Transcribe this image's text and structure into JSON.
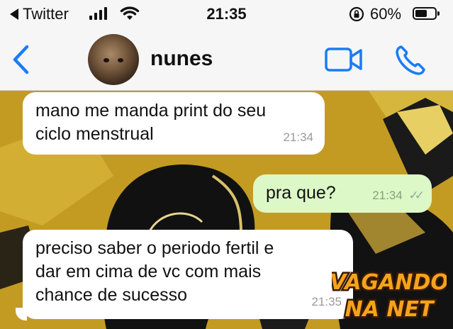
{
  "status_bar": {
    "back_app_label": "Twitter",
    "time": "21:35",
    "battery_percent": "60%",
    "battery_level": 0.6
  },
  "header": {
    "contact_name": "nunes",
    "icons": [
      "back-chevron-icon",
      "avatar",
      "video-call-icon",
      "phone-call-icon"
    ]
  },
  "messages": [
    {
      "direction": "incoming",
      "text_lines": [
        "mano me manda print do seu",
        "ciclo menstrual"
      ],
      "time": "21:34"
    },
    {
      "direction": "outgoing",
      "text_lines": [
        "pra que?"
      ],
      "time": "21:34",
      "status": "read"
    },
    {
      "direction": "incoming",
      "text_lines": [
        "preciso saber o periodo fertil e",
        "dar em cima de vc com mais",
        "chance de sucesso"
      ],
      "time": "21:35"
    }
  ],
  "watermark": {
    "line1": "VAGANDO",
    "line2": "NA NET"
  },
  "colors": {
    "accent_blue": "#1a7cf5",
    "incoming_bubble": "#ffffff",
    "outgoing_bubble": "#dcf8c6",
    "wallpaper_gold": "#c9a227"
  }
}
